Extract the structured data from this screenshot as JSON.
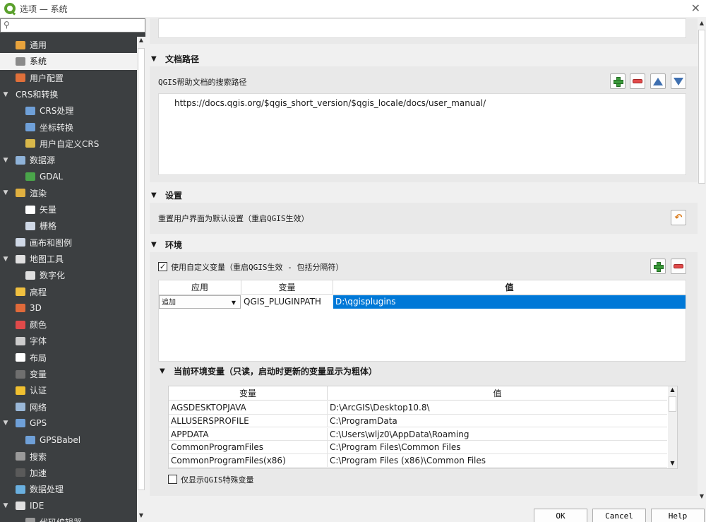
{
  "window": {
    "title": "选项 — 系统"
  },
  "search": {
    "placeholder": ""
  },
  "sidebar": {
    "items": [
      {
        "label": "通用",
        "level": 0,
        "expander": "",
        "icon": "tools-icon",
        "selected": false
      },
      {
        "label": "系统",
        "level": 0,
        "expander": "",
        "icon": "system-gear-icon",
        "selected": true
      },
      {
        "label": "用户配置",
        "level": 0,
        "expander": "",
        "icon": "user-icon",
        "selected": false
      },
      {
        "label": "CRS和转换",
        "level": 0,
        "expander": "▼",
        "icon": "",
        "selected": false
      },
      {
        "label": "CRS处理",
        "level": 1,
        "expander": "",
        "icon": "globe-icon",
        "selected": false
      },
      {
        "label": "坐标转换",
        "level": 1,
        "expander": "",
        "icon": "globe-transform-icon",
        "selected": false
      },
      {
        "label": "用户自定义CRS",
        "level": 1,
        "expander": "",
        "icon": "custom-crs-icon",
        "selected": false
      },
      {
        "label": "数据源",
        "level": 0,
        "expander": "▼",
        "icon": "table-icon",
        "selected": false
      },
      {
        "label": "GDAL",
        "level": 1,
        "expander": "",
        "icon": "gdal-icon",
        "selected": false
      },
      {
        "label": "渲染",
        "level": 0,
        "expander": "▼",
        "icon": "brush-icon",
        "selected": false
      },
      {
        "label": "矢量",
        "level": 1,
        "expander": "",
        "icon": "vector-icon",
        "selected": false
      },
      {
        "label": "栅格",
        "level": 1,
        "expander": "",
        "icon": "raster-icon",
        "selected": false
      },
      {
        "label": "画布和图例",
        "level": 0,
        "expander": "",
        "icon": "canvas-icon",
        "selected": false
      },
      {
        "label": "地图工具",
        "level": 0,
        "expander": "▼",
        "icon": "map-tools-icon",
        "selected": false
      },
      {
        "label": "数字化",
        "level": 1,
        "expander": "",
        "icon": "digitize-icon",
        "selected": false
      },
      {
        "label": "高程",
        "level": 0,
        "expander": "",
        "icon": "elevation-icon",
        "selected": false
      },
      {
        "label": "3D",
        "level": 0,
        "expander": "",
        "icon": "cube-icon",
        "selected": false
      },
      {
        "label": "颜色",
        "level": 0,
        "expander": "",
        "icon": "color-icon",
        "selected": false
      },
      {
        "label": "字体",
        "level": 0,
        "expander": "",
        "icon": "font-icon",
        "selected": false
      },
      {
        "label": "布局",
        "level": 0,
        "expander": "",
        "icon": "layout-icon",
        "selected": false
      },
      {
        "label": "变量",
        "level": 0,
        "expander": "",
        "icon": "variable-icon",
        "selected": false
      },
      {
        "label": "认证",
        "level": 0,
        "expander": "",
        "icon": "lock-icon",
        "selected": false
      },
      {
        "label": "网络",
        "level": 0,
        "expander": "",
        "icon": "network-icon",
        "selected": false
      },
      {
        "label": "GPS",
        "level": 0,
        "expander": "▼",
        "icon": "gps-icon",
        "selected": false
      },
      {
        "label": "GPSBabel",
        "level": 1,
        "expander": "",
        "icon": "gpsbabel-icon",
        "selected": false
      },
      {
        "label": "搜索",
        "level": 0,
        "expander": "",
        "icon": "search-icon",
        "selected": false
      },
      {
        "label": "加速",
        "level": 0,
        "expander": "",
        "icon": "acceleration-icon",
        "selected": false
      },
      {
        "label": "数据处理",
        "level": 0,
        "expander": "",
        "icon": "processing-icon",
        "selected": false
      },
      {
        "label": "IDE",
        "level": 0,
        "expander": "▼",
        "icon": "ide-icon",
        "selected": false
      },
      {
        "label": "代码编辑器",
        "level": 1,
        "expander": "",
        "icon": "code-editor-icon",
        "selected": false
      }
    ]
  },
  "docpath": {
    "title": "文档路径",
    "label": "QGIS帮助文档的搜索路径",
    "paths": [
      "https://docs.qgis.org/$qgis_short_version/$qgis_locale/docs/user_manual/"
    ]
  },
  "settings": {
    "title": "设置",
    "reset_label": "重置用户界面为默认设置（重启QGIS生效）"
  },
  "environment": {
    "title": "环境",
    "use_custom_label": "使用自定义变量（重启QGIS生效 - 包括分隔符）",
    "use_custom_checked": "✓",
    "columns": [
      "应用",
      "变量",
      "值"
    ],
    "rows": [
      {
        "apply": "追加",
        "variable": "QGIS_PLUGINPATH",
        "value": "D:\\qgisplugins"
      }
    ],
    "current": {
      "title": "当前环境变量（只读，启动时更新的变量显示为粗体）",
      "columns": [
        "变量",
        "值"
      ],
      "rows": [
        {
          "key": "AGSDESKTOPJAVA",
          "value": "D:\\ArcGIS\\Desktop10.8\\"
        },
        {
          "key": "ALLUSERSPROFILE",
          "value": "C:\\ProgramData"
        },
        {
          "key": "APPDATA",
          "value": "C:\\Users\\wljz0\\AppData\\Roaming"
        },
        {
          "key": "CommonProgramFiles",
          "value": "C:\\Program Files\\Common Files"
        },
        {
          "key": "CommonProgramFiles(x86)",
          "value": "C:\\Program Files (x86)\\Common Files"
        }
      ]
    },
    "only_qgis_label": "仅显示QGIS特殊变量"
  },
  "buttons": {
    "ok": "OK",
    "cancel": "Cancel",
    "help": "Help"
  }
}
